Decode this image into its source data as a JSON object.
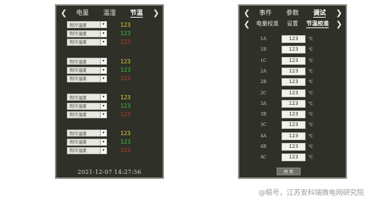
{
  "left_panel": {
    "nav": {
      "prev": "❮",
      "next": "❯",
      "tabs": [
        "电量",
        "温湿",
        "节温"
      ],
      "active_tab": 2
    },
    "groups": [
      {
        "rows": [
          {
            "select": "制冷温度",
            "value": "123",
            "color": "#e8d23a"
          },
          {
            "select": "制冷温度",
            "value": "123",
            "color": "#3fbf3f"
          },
          {
            "select": "制冷温度",
            "value": "123",
            "color": "#c23b2e"
          }
        ]
      },
      {
        "rows": [
          {
            "select": "制冷温度",
            "value": "123",
            "color": "#e8d23a"
          },
          {
            "select": "制冷温度",
            "value": "123",
            "color": "#3fbf3f"
          },
          {
            "select": "制冷温度",
            "value": "123",
            "color": "#c23b2e"
          }
        ]
      },
      {
        "rows": [
          {
            "select": "制冷温度",
            "value": "123",
            "color": "#e8d23a"
          },
          {
            "select": "制冷温度",
            "value": "123",
            "color": "#3fbf3f"
          },
          {
            "select": "制冷温度",
            "value": "123",
            "color": "#c23b2e"
          }
        ]
      },
      {
        "rows": [
          {
            "select": "制冷温度",
            "value": "123",
            "color": "#e8d23a"
          },
          {
            "select": "制冷温度",
            "value": "123",
            "color": "#3fbf3f"
          },
          {
            "select": "制冷温度",
            "value": "123",
            "color": "#c23b2e"
          }
        ]
      }
    ],
    "dropdown_icon": "chevron-down-icon",
    "datetime": "2021-12-07  14:27:56"
  },
  "right_panel": {
    "nav_top": {
      "prev": "❮",
      "next": "❯",
      "tabs": [
        "事件",
        "参数",
        "调试"
      ],
      "active_tab": 2
    },
    "nav_sub": {
      "prev": "❮",
      "next": "❯",
      "tabs": [
        "电量校准",
        "设置",
        "节温校准"
      ],
      "active_tab": 2
    },
    "calibration": [
      {
        "label": "1A",
        "value": "123",
        "unit": "℃"
      },
      {
        "label": "1B",
        "value": "123",
        "unit": "℃"
      },
      {
        "label": "1C",
        "value": "123",
        "unit": "℃"
      },
      {
        "label": "2A",
        "value": "123",
        "unit": "℃"
      },
      {
        "label": "2B",
        "value": "123",
        "unit": "℃"
      },
      {
        "label": "2C",
        "value": "123",
        "unit": "℃"
      },
      {
        "label": "3A",
        "value": "123",
        "unit": "℃"
      },
      {
        "label": "3B",
        "value": "123",
        "unit": "℃"
      },
      {
        "label": "3C",
        "value": "123",
        "unit": "℃"
      },
      {
        "label": "4A",
        "value": "123",
        "unit": "℃"
      },
      {
        "label": "4B",
        "value": "123",
        "unit": "℃"
      },
      {
        "label": "4C",
        "value": "123",
        "unit": "℃"
      }
    ],
    "refresh_label": "刷 新"
  },
  "watermark": "@稿号，江苏安科瑞微电网研究院"
}
